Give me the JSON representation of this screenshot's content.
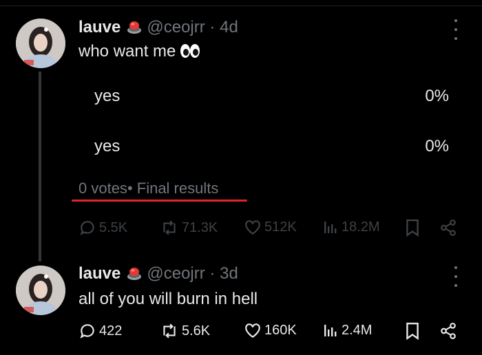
{
  "tweets": [
    {
      "display_name": "lauve",
      "handle": "@ceojrr",
      "separator": "·",
      "time": "4d",
      "text": "who want me",
      "emoji_icon": "eyes-emoji-icon",
      "poll": {
        "options": [
          {
            "label": "yes",
            "percent": "0%"
          },
          {
            "label": "yes",
            "percent": "0%"
          }
        ],
        "votes": "0 votes",
        "status": "• Final results"
      },
      "stats": {
        "replies": "5.5K",
        "reposts": "71.3K",
        "likes": "512K",
        "views": "18.2M"
      }
    },
    {
      "display_name": "lauve",
      "handle": "@ceojrr",
      "separator": "·",
      "time": "3d",
      "text": "all of you will burn in hell",
      "stats": {
        "replies": "422",
        "reposts": "5.6K",
        "likes": "160K",
        "views": "2.4M"
      }
    }
  ],
  "colors": {
    "background": "#000000",
    "text": "#e7e9ea",
    "secondary": "#71767b",
    "annotation_underline": "#e0242b"
  },
  "icons": [
    "more-icon",
    "reply-icon",
    "repost-icon",
    "like-icon",
    "views-icon",
    "bookmark-icon",
    "share-icon",
    "red-button-badge-icon"
  ]
}
